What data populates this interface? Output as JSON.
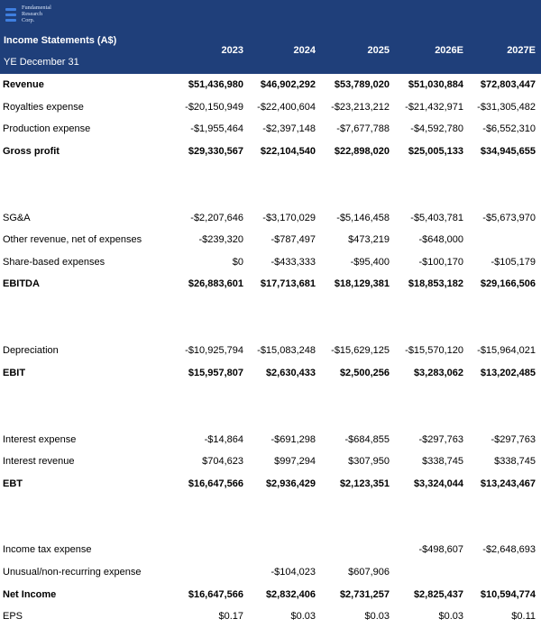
{
  "header": {
    "logo_lines": [
      "Fundamental",
      "Research",
      "Corp."
    ],
    "title": "Income Statements (A$)",
    "year_end": "YE December 31",
    "years": [
      "2023",
      "2024",
      "2025",
      "2026E",
      "2027E"
    ]
  },
  "rows": [
    {
      "label": "Revenue",
      "bold": true,
      "values": [
        "$51,436,980",
        "$46,902,292",
        "$53,789,020",
        "$51,030,884",
        "$72,803,447"
      ]
    },
    {
      "label": "Royalties expense",
      "bold": false,
      "values": [
        "-$20,150,949",
        "-$22,400,604",
        "-$23,213,212",
        "-$21,432,971",
        "-$31,305,482"
      ]
    },
    {
      "label": "Production expense",
      "bold": false,
      "values": [
        "-$1,955,464",
        "-$2,397,148",
        "-$7,677,788",
        "-$4,592,780",
        "-$6,552,310"
      ]
    },
    {
      "label": "Gross profit",
      "bold": true,
      "values": [
        "$29,330,567",
        "$22,104,540",
        "$22,898,020",
        "$25,005,133",
        "$34,945,655"
      ]
    },
    {
      "spacer": true
    },
    {
      "spacer": true
    },
    {
      "label": "SG&A",
      "bold": false,
      "values": [
        "-$2,207,646",
        "-$3,170,029",
        "-$5,146,458",
        "-$5,403,781",
        "-$5,673,970"
      ]
    },
    {
      "label": "Other revenue, net of expenses",
      "bold": false,
      "values": [
        "-$239,320",
        "-$787,497",
        "$473,219",
        "-$648,000",
        ""
      ]
    },
    {
      "label": "Share-based expenses",
      "bold": false,
      "values": [
        "$0",
        "-$433,333",
        "-$95,400",
        "-$100,170",
        "-$105,179"
      ]
    },
    {
      "label": "EBITDA",
      "bold": true,
      "values": [
        "$26,883,601",
        "$17,713,681",
        "$18,129,381",
        "$18,853,182",
        "$29,166,506"
      ]
    },
    {
      "spacer": true
    },
    {
      "spacer": true
    },
    {
      "label": "Depreciation",
      "bold": false,
      "values": [
        "-$10,925,794",
        "-$15,083,248",
        "-$15,629,125",
        "-$15,570,120",
        "-$15,964,021"
      ]
    },
    {
      "label": "EBIT",
      "bold": true,
      "values": [
        "$15,957,807",
        "$2,630,433",
        "$2,500,256",
        "$3,283,062",
        "$13,202,485"
      ]
    },
    {
      "spacer": true
    },
    {
      "spacer": true
    },
    {
      "label": "Interest expense",
      "bold": false,
      "values": [
        "-$14,864",
        "-$691,298",
        "-$684,855",
        "-$297,763",
        "-$297,763"
      ]
    },
    {
      "label": "Interest revenue",
      "bold": false,
      "values": [
        "$704,623",
        "$997,294",
        "$307,950",
        "$338,745",
        "$338,745"
      ]
    },
    {
      "label": "EBT",
      "bold": true,
      "values": [
        "$16,647,566",
        "$2,936,429",
        "$2,123,351",
        "$3,324,044",
        "$13,243,467"
      ]
    },
    {
      "spacer": true
    },
    {
      "spacer": true
    },
    {
      "label": "Income tax expense",
      "bold": false,
      "values": [
        "",
        "",
        "",
        "-$498,607",
        "-$2,648,693"
      ]
    },
    {
      "label": "Unusual/non-recurring expense",
      "bold": false,
      "values": [
        "",
        "-$104,023",
        "$607,906",
        "",
        ""
      ]
    },
    {
      "label": "Net Income",
      "bold": true,
      "values": [
        "$16,647,566",
        "$2,832,406",
        "$2,731,257",
        "$2,825,437",
        "$10,594,774"
      ]
    },
    {
      "label": "EPS",
      "bold": false,
      "values": [
        "$0.17",
        "$0.03",
        "$0.03",
        "$0.03",
        "$0.11"
      ]
    }
  ],
  "colors": {
    "header_bg": "#1f3f7a",
    "header_text": "#ffffff",
    "logo_mark": "#3f7fe0"
  }
}
